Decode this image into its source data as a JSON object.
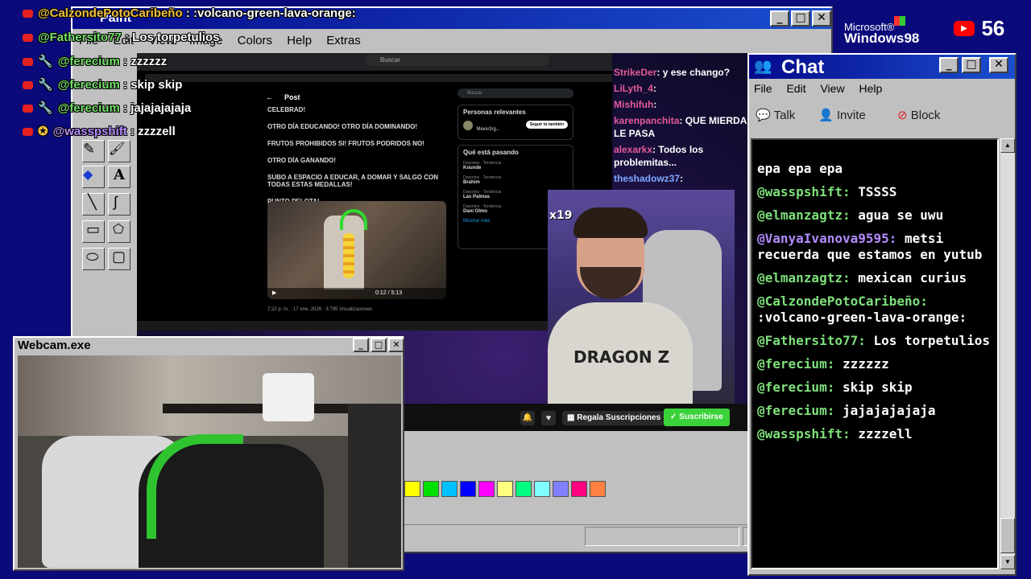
{
  "overlay_chat": [
    {
      "user": "@CalzondePotoCaribeño",
      "message": ":volcano-green-lava-orange:"
    },
    {
      "user": "@Fathersito77",
      "message": "Los torpetulios"
    },
    {
      "user": "@ferecium",
      "message": "zzzzzz"
    },
    {
      "user": "@ferecium",
      "message": "skip skip"
    },
    {
      "user": "@ferecium",
      "message": "jajajajajaja"
    },
    {
      "user": "@wasspshift",
      "message": "zzzzell"
    }
  ],
  "paint": {
    "title": "Paint",
    "menu": [
      "File",
      "Edit",
      "View",
      "Image",
      "Colors",
      "Help",
      "Extras"
    ],
    "palette": [
      "#ffff00",
      "#00e000",
      "#00c0ff",
      "#0000ff",
      "#ff00ff",
      "#ffff80",
      "#00ff80",
      "#80ffff",
      "#8080ff",
      "#ff0080",
      "#ff8040"
    ]
  },
  "win98_logo": {
    "line1": "Microsoft®",
    "line2": "Windows98"
  },
  "youtube_viewers": "56",
  "browser": {
    "search_placeholder": "Buscar",
    "post_header": "Post",
    "side_search": "Buscar",
    "tweet_lines": [
      "CELEBRAD!",
      "OTRO DÍA EDUCANDO! OTRO DÍA DOMINANDO!",
      "FRUTOS PROHIBIDOS SI! FRUTOS PODRIDOS NO!",
      "OTRO DÍA GANANDO!",
      "SUBO A ESPACIO A EDUCAR, A DOMAR Y SALGO CON TODAS ESTAS MEDALLAS!",
      "PUNTO PELOTA!"
    ],
    "video_time": "0:12 / 5:13",
    "tweet_footer": "7:22 p. m. · 17 ene. 2026 · 3.795 Visualizaciones",
    "relevant_title": "Personas relevantes",
    "relevant_user": "Mexiv3rg...",
    "follow_btn": "Seguir tú también",
    "trending_title": "Qué está pasando",
    "trends": [
      {
        "cat": "Deportes · Tendencia",
        "name": "Kounde"
      },
      {
        "cat": "Deportes · Tendencia",
        "name": "Brahim"
      },
      {
        "cat": "Deportes · Tendencia",
        "name": "Las Palmas"
      },
      {
        "cat": "Deportes · Tendencia",
        "name": "Dani Olmo"
      }
    ],
    "show_more": "Mostrar más"
  },
  "stream_chat": [
    {
      "user": "StrikeDer",
      "message": ": y ese chango?"
    },
    {
      "user": "LiLyth_4",
      "message": ":"
    },
    {
      "user": "Mishifuh",
      "message": ":"
    },
    {
      "user": "karenpanchita",
      "message": ": QUE MIERDA LE PASA"
    },
    {
      "user": "alexarkx",
      "message": ": Todos los problemitas..."
    },
    {
      "user": "theshadowz37",
      "message": ":"
    }
  ],
  "multiplier": "x19",
  "channel_bar": {
    "gift": "Regala Suscripciones",
    "subscribe": "Suscribirse"
  },
  "webcam": {
    "title": "Webcam.exe"
  },
  "chat": {
    "title": "Chat",
    "menu": [
      "File",
      "Edit",
      "View",
      "Help"
    ],
    "toolbar": {
      "talk": "Talk",
      "invite": "Invite",
      "block": "Block"
    },
    "messages": [
      {
        "user": "",
        "message": "epa epa epa",
        "purple": false
      },
      {
        "user": "@wasspshift:",
        "message": "TSSSS",
        "purple": false
      },
      {
        "user": "@elmanzagtz:",
        "message": "agua se uwu",
        "purple": false
      },
      {
        "user": "@VanyaIvanova9595:",
        "message": "metsi recuerda que estamos en yutub",
        "purple": true
      },
      {
        "user": "@elmanzagtz:",
        "message": "mexican curius",
        "purple": false
      },
      {
        "user": "@CalzondePotoCaribeño:",
        "message": ":volcano-green-lava-orange:",
        "purple": false
      },
      {
        "user": "@Fathersito77:",
        "message": "Los torpetulios",
        "purple": false
      },
      {
        "user": "@ferecium:",
        "message": "zzzzzz",
        "purple": false
      },
      {
        "user": "@ferecium:",
        "message": "skip skip",
        "purple": false
      },
      {
        "user": "@ferecium:",
        "message": "jajajajajaja",
        "purple": false
      },
      {
        "user": "@wasspshift:",
        "message": "zzzzell",
        "purple": false
      }
    ]
  },
  "colors": {
    "desktop": "#0b0a7a",
    "title_start": "#050a8a",
    "title_end": "#1a4fd0",
    "subscribe": "#3ad13a"
  }
}
